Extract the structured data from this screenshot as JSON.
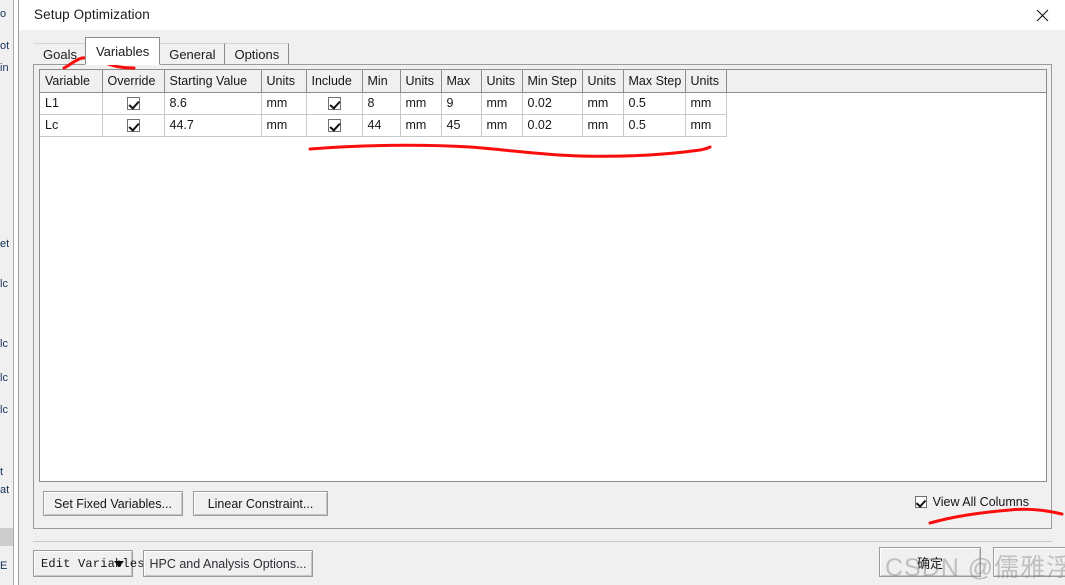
{
  "window": {
    "title": "Setup Optimization",
    "close_icon": "close-x-icon"
  },
  "tabs": [
    {
      "label": "Goals",
      "active": false
    },
    {
      "label": "Variables",
      "active": true
    },
    {
      "label": "General",
      "active": false
    },
    {
      "label": "Options",
      "active": false
    }
  ],
  "table": {
    "columns": [
      "Variable",
      "Override",
      "Starting Value",
      "Units",
      "Include",
      "Min",
      "Units",
      "Max",
      "Units",
      "Min Step",
      "Units",
      "Max Step",
      "Units",
      ""
    ],
    "rows": [
      {
        "variable": "L1",
        "override": "checked",
        "starting_value": "8.6",
        "units1": "mm",
        "include": "checked",
        "min": "8",
        "units2": "mm",
        "max": "9",
        "units3": "mm",
        "min_step": "0.02",
        "units4": "mm",
        "max_step": "0.5",
        "units5": "mm"
      },
      {
        "variable": "Lc",
        "override": "checked",
        "starting_value": "44.7",
        "units1": "mm",
        "include": "checked",
        "min": "44",
        "units2": "mm",
        "max": "45",
        "units3": "mm",
        "min_step": "0.02",
        "units4": "mm",
        "max_step": "0.5",
        "units5": "mm"
      }
    ]
  },
  "panel_controls": {
    "set_fixed_variables": "Set Fixed Variables...",
    "linear_constraint": "Linear Constraint...",
    "view_all_columns": {
      "label": "View All Columns",
      "checked": true
    }
  },
  "footer": {
    "edit_variables": "Edit Variables",
    "edit_variables_caret": "chevron-down-icon",
    "hpc_options": "HPC and Analysis Options...",
    "ok": "确定",
    "cancel": ""
  },
  "annotations": {
    "color": "#fb0d0d",
    "marks": [
      "underline-variables-tab",
      "underline-table-row-range",
      "underline-view-all-columns"
    ]
  },
  "watermark": {
    "text": "CSDN @儒雅浮缘"
  },
  "background_window": {
    "fragments": [
      "o",
      "ot",
      "in",
      "et",
      "lc",
      "lc",
      "lc",
      "lc",
      "t",
      "at",
      "E"
    ]
  }
}
